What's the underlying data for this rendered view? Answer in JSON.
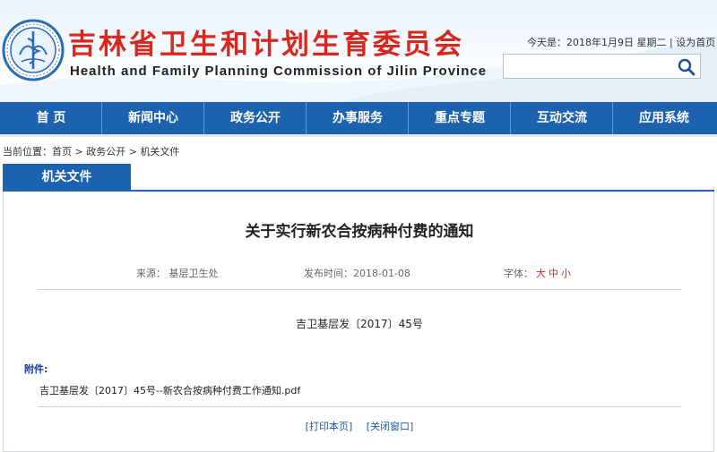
{
  "header": {
    "title": "吉林省卫生和计划生育委员会",
    "subtitle": "Health and Family Planning Commission of Jilin Province",
    "today_label": "今天是：",
    "today_date": "2018年1月9日",
    "weekday": "星期二",
    "separator": " | ",
    "set_homepage": "设为首页",
    "logo_icon": "provincial-emblem-logo"
  },
  "search": {
    "placeholder": "",
    "value": "",
    "icon": "search-icon"
  },
  "nav": {
    "items": [
      {
        "label": "首 页"
      },
      {
        "label": "新闻中心"
      },
      {
        "label": "政务公开"
      },
      {
        "label": "办事服务"
      },
      {
        "label": "重点专题"
      },
      {
        "label": "互动交流"
      },
      {
        "label": "应用系统"
      }
    ]
  },
  "breadcrumb": {
    "prefix": "当前位置：",
    "items": [
      "首页",
      "政务公开",
      "机关文件"
    ],
    "sep": " > "
  },
  "section": {
    "tab_label": "机关文件"
  },
  "article": {
    "title": "关于实行新农合按病种付费的通知",
    "source_label": "来源：",
    "source": "基层卫生处",
    "date_label": "发布时间：",
    "date": "2018-01-08",
    "font_label": "字体：",
    "font_large": "大",
    "font_medium": "中",
    "font_small": "小",
    "doc_number": "吉卫基层发〔2017〕45号",
    "attachment_label": "附件:",
    "attachment_file": "吉卫基层发〔2017〕45号--新农合按病种付费工作通知.pdf",
    "print_label": "[打印本页]",
    "close_label": "[关闭窗口]"
  },
  "colors": {
    "brand_blue": "#1c62ae",
    "title_red": "#d6281f",
    "link_blue": "#1b5aa8"
  }
}
